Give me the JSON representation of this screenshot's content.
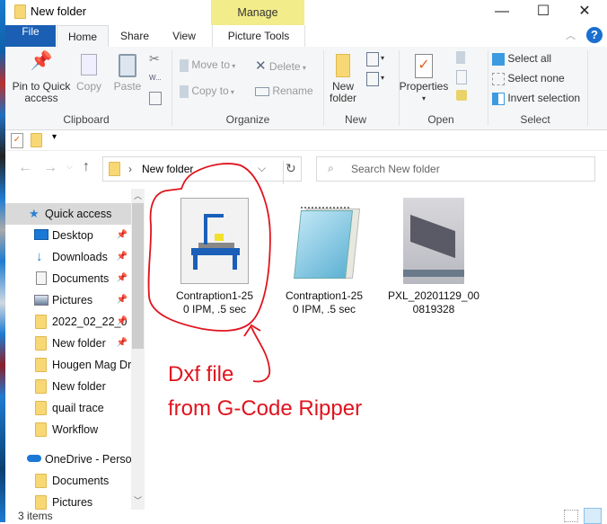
{
  "window": {
    "title": "New folder",
    "contextual_tab_group": "Manage",
    "controls": {
      "minimize": "—",
      "maximize": "☐",
      "close": "✕"
    }
  },
  "tabs": [
    {
      "label": "File",
      "active": false
    },
    {
      "label": "Home",
      "active": true
    },
    {
      "label": "Share",
      "active": false
    },
    {
      "label": "View",
      "active": false
    },
    {
      "label": "Picture Tools",
      "active": false
    }
  ],
  "ribbon": {
    "clipboard": {
      "label": "Clipboard",
      "pin_line1": "Pin to Quick",
      "pin_line2": "access",
      "copy": "Copy",
      "paste": "Paste"
    },
    "organize": {
      "label": "Organize",
      "move_to": "Move to",
      "copy_to": "Copy to",
      "delete": "Delete",
      "rename": "Rename"
    },
    "new": {
      "label": "New",
      "new_folder_line1": "New",
      "new_folder_line2": "folder"
    },
    "open": {
      "label": "Open",
      "properties": "Properties"
    },
    "select": {
      "label": "Select",
      "select_all": "Select all",
      "select_none": "Select none",
      "invert_selection": "Invert selection"
    }
  },
  "address": {
    "path": "New folder",
    "search_placeholder": "Search New folder"
  },
  "nav_pane": {
    "quick_access": "Quick access",
    "items": [
      {
        "label": "Desktop",
        "icon": "desktop-icon",
        "pinned": true
      },
      {
        "label": "Downloads",
        "icon": "downloads-icon",
        "pinned": true
      },
      {
        "label": "Documents",
        "icon": "documents-icon",
        "pinned": true
      },
      {
        "label": "Pictures",
        "icon": "pictures-icon",
        "pinned": true
      },
      {
        "label": "2022_02_22_0",
        "icon": "folder-icon",
        "pinned": true
      },
      {
        "label": "New folder",
        "icon": "folder-icon",
        "pinned": true
      },
      {
        "label": "Hougen Mag Dr",
        "icon": "folder-icon",
        "pinned": false
      },
      {
        "label": "New folder",
        "icon": "folder-icon",
        "pinned": false
      },
      {
        "label": "quail trace",
        "icon": "folder-icon",
        "pinned": false
      },
      {
        "label": "Workflow",
        "icon": "folder-icon",
        "pinned": false
      }
    ],
    "onedrive": "OneDrive - Persor",
    "onedrive_items": [
      {
        "label": "Documents",
        "icon": "folder-icon"
      },
      {
        "label": "Pictures",
        "icon": "folder-icon"
      }
    ]
  },
  "files": [
    {
      "line1": "Contraption1-25",
      "line2": "0 IPM, .5 sec",
      "icon": "dxf-cnc-file-icon"
    },
    {
      "line1": "Contraption1-25",
      "line2": "0 IPM, .5 sec",
      "icon": "notepad-file-icon"
    },
    {
      "line1": "PXL_20201129_00",
      "line2": "0819328",
      "icon": "image-thumbnail"
    }
  ],
  "annotation": {
    "line1": "Dxf file",
    "line2": "from G-Code Ripper",
    "color": "#e0141e"
  },
  "status": {
    "item_count": "3 items"
  }
}
